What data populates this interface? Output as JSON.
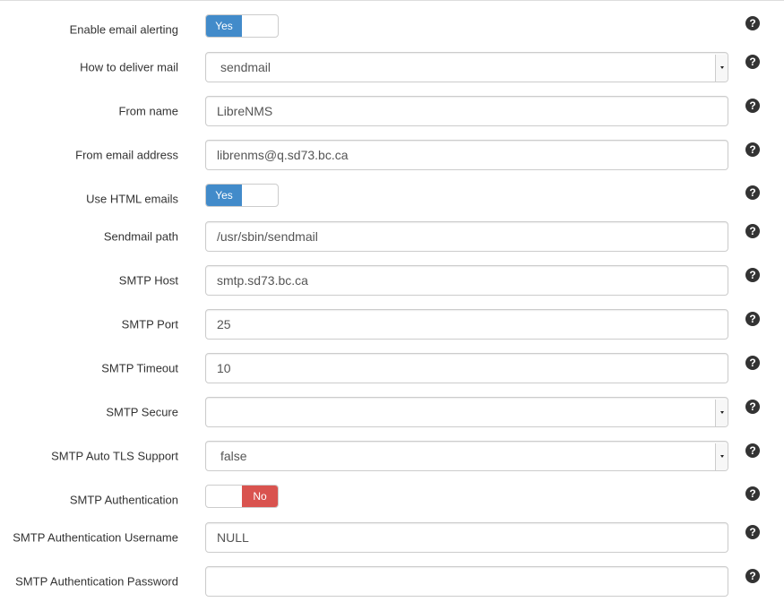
{
  "fields": [
    {
      "label": "Enable email alerting",
      "type": "toggle",
      "state": "on",
      "toggle_label": "Yes"
    },
    {
      "label": "How to deliver mail",
      "type": "select",
      "value": "sendmail"
    },
    {
      "label": "From name",
      "type": "text",
      "value": "LibreNMS"
    },
    {
      "label": "From email address",
      "type": "text",
      "value": "librenms@q.sd73.bc.ca"
    },
    {
      "label": "Use HTML emails",
      "type": "toggle",
      "state": "on",
      "toggle_label": "Yes"
    },
    {
      "label": "Sendmail path",
      "type": "text",
      "value": "/usr/sbin/sendmail"
    },
    {
      "label": "SMTP Host",
      "type": "text",
      "value": "smtp.sd73.bc.ca"
    },
    {
      "label": "SMTP Port",
      "type": "text",
      "value": "25"
    },
    {
      "label": "SMTP Timeout",
      "type": "text",
      "value": "10"
    },
    {
      "label": "SMTP Secure",
      "type": "select",
      "value": ""
    },
    {
      "label": "SMTP Auto TLS Support",
      "type": "select",
      "value": "false"
    },
    {
      "label": "SMTP Authentication",
      "type": "toggle",
      "state": "off",
      "toggle_label": "No"
    },
    {
      "label": "SMTP Authentication Username",
      "type": "text",
      "value": "NULL"
    },
    {
      "label": "SMTP Authentication Password",
      "type": "text",
      "value": ""
    }
  ],
  "help_icon": "question-circle-icon",
  "help_glyph": "?",
  "colors": {
    "toggle_on": "#428bca",
    "toggle_off": "#d9534f",
    "help_icon": "#333333"
  }
}
